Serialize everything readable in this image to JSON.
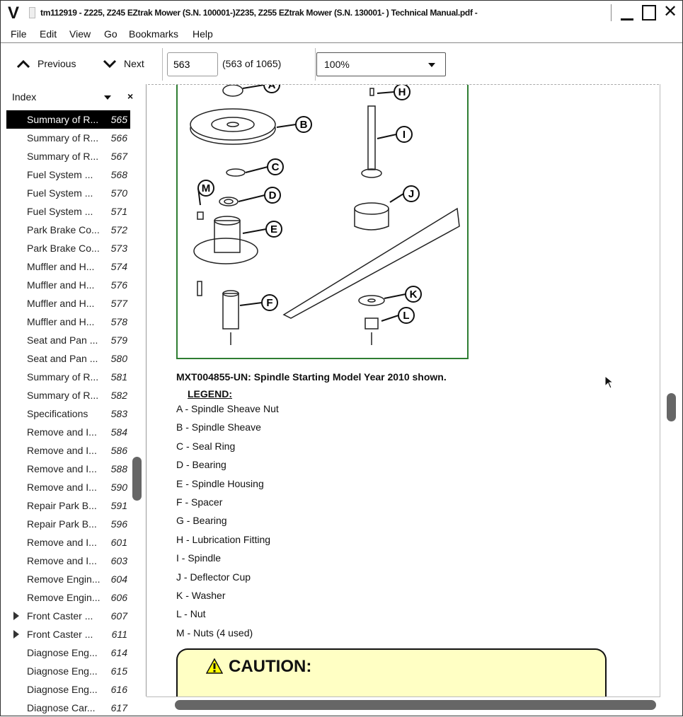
{
  "window": {
    "title": "tm112919 - Z225, Z245 EZtrak Mower (S.N. 100001-)Z235, Z255 EZtrak Mower (S.N. 130001- ) Technical Manual.pdf -",
    "logo": "V"
  },
  "menu": [
    "File",
    "Edit",
    "View",
    "Go",
    "Bookmarks",
    "Help"
  ],
  "toolbar": {
    "previous": "Previous",
    "next": "Next",
    "page_value": "563",
    "page_count": "(563 of 1065)",
    "zoom": "100%"
  },
  "sidebar": {
    "title": "Index",
    "items": [
      {
        "label": "Summary of R...",
        "page": "565",
        "selected": true
      },
      {
        "label": "Summary of R...",
        "page": "566"
      },
      {
        "label": "Summary of R...",
        "page": "567"
      },
      {
        "label": "Fuel System ...",
        "page": "568"
      },
      {
        "label": "Fuel System ...",
        "page": "570"
      },
      {
        "label": "Fuel System ...",
        "page": "571"
      },
      {
        "label": "Park Brake Co...",
        "page": "572"
      },
      {
        "label": "Park Brake Co...",
        "page": "573"
      },
      {
        "label": "Muffler and H...",
        "page": "574"
      },
      {
        "label": "Muffler and H...",
        "page": "576"
      },
      {
        "label": "Muffler and H...",
        "page": "577"
      },
      {
        "label": "Muffler and H...",
        "page": "578"
      },
      {
        "label": "Seat and Pan ...",
        "page": "579"
      },
      {
        "label": "Seat and Pan ...",
        "page": "580"
      },
      {
        "label": "Summary of R...",
        "page": "581"
      },
      {
        "label": "Summary of R...",
        "page": "582"
      },
      {
        "label": "Specifications",
        "page": "583"
      },
      {
        "label": "Remove and I...",
        "page": "584"
      },
      {
        "label": "Remove and I...",
        "page": "586"
      },
      {
        "label": "Remove and I...",
        "page": "588"
      },
      {
        "label": "Remove and I...",
        "page": "590"
      },
      {
        "label": "Repair Park B...",
        "page": "591"
      },
      {
        "label": "Repair Park B...",
        "page": "596"
      },
      {
        "label": "Remove and I...",
        "page": "601"
      },
      {
        "label": "Remove and I...",
        "page": "603"
      },
      {
        "label": "Remove Engin...",
        "page": "604"
      },
      {
        "label": "Remove Engin...",
        "page": "606"
      },
      {
        "label": "Front Caster ...",
        "page": "607",
        "expandable": true
      },
      {
        "label": "Front Caster ...",
        "page": "611",
        "expandable": true
      },
      {
        "label": "Diagnose Eng...",
        "page": "614"
      },
      {
        "label": "Diagnose Eng...",
        "page": "615"
      },
      {
        "label": "Diagnose Eng...",
        "page": "616"
      },
      {
        "label": "Diagnose Car...",
        "page": "617"
      }
    ]
  },
  "document": {
    "figure_labels": [
      "A",
      "B",
      "C",
      "D",
      "E",
      "F",
      "H",
      "I",
      "J",
      "K",
      "L",
      "M"
    ],
    "caption": "MXT004855-UN: Spindle Starting Model Year 2010 shown.",
    "legend_title": "LEGEND:",
    "legend": [
      "A - Spindle Sheave Nut",
      "B - Spindle Sheave",
      "C - Seal Ring",
      "D - Bearing",
      "E - Spindle Housing",
      "F - Spacer",
      "G - Bearing",
      "H - Lubrication Fitting",
      "I - Spindle",
      "J - Deflector Cup",
      "K - Washer",
      "L - Nut",
      "M - Nuts (4 used)"
    ],
    "caution_title": "CAUTION:",
    "caution_color": "#ffffc4",
    "figure_border_color": "#2e7d32"
  }
}
